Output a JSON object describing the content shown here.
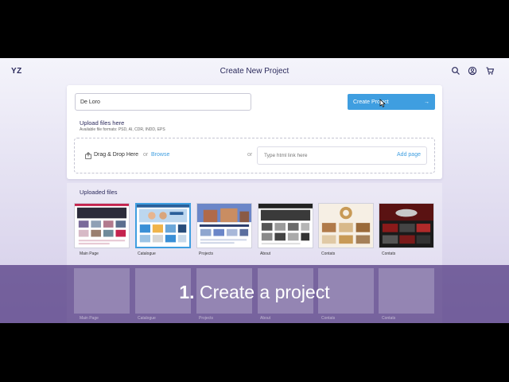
{
  "app": {
    "logo": "YZ",
    "title": "Create New Project"
  },
  "toolbar": {
    "search_icon": "search-icon",
    "account_icon": "user-circle-icon",
    "cart_icon": "cart-icon"
  },
  "form": {
    "project_name_value": "De Loro",
    "create_button_label": "Create Project",
    "create_button_arrow": "→"
  },
  "upload": {
    "title": "Upload files here",
    "hint": "Available file formats: PSD, AI, CDR, INDD, EPS",
    "drag_label": "Drag & Drop Here",
    "or_label": "or",
    "browse_label": "Browse",
    "separator": "or",
    "link_placeholder": "Type html link here",
    "add_page_label": "Add page"
  },
  "uploaded": {
    "title": "Uploaded files",
    "items": [
      {
        "label": "Main Page",
        "accent": "#c4234e"
      },
      {
        "label": "Catalogue",
        "accent": "#3a8fd6"
      },
      {
        "label": "Projects",
        "accent": "#6b86c8"
      },
      {
        "label": "About",
        "accent": "#222222"
      },
      {
        "label": "Contats",
        "accent": "#c89a56"
      },
      {
        "label": "Contats",
        "accent": "#8a1a1a"
      }
    ]
  },
  "ghost_labels": [
    "Main Page",
    "Catalogue",
    "Projects",
    "About",
    "Contats",
    "Contats"
  ],
  "caption": {
    "number": "1.",
    "text": "Create a project"
  },
  "colors": {
    "accent": "#3f9ee0",
    "overlay": "#4e347e"
  }
}
